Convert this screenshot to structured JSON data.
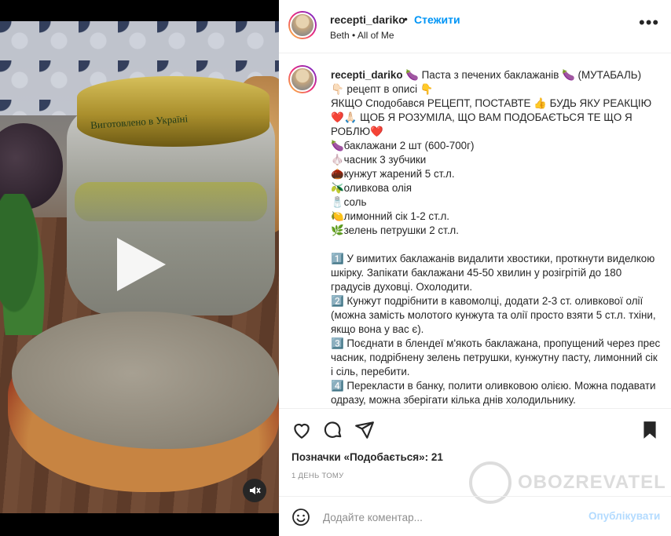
{
  "media": {
    "lid_text": "Виготовлено в Україні",
    "play_icon": "play-icon",
    "mute_icon": "muted-speaker-icon"
  },
  "header": {
    "username": "recepti_dariko",
    "separator": "•",
    "follow_label": "Стежити",
    "music": "Beth • All of Me",
    "more_icon": "more-options-icon"
  },
  "caption": {
    "username": "recepti_dariko",
    "text": " 🍆 Паста з печених баклажанів 🍆 (МУТАБАЛЬ)\n👇🏻 рецепт в описі 👇\nЯКЩО Сподобався РЕЦЕПТ, ПОСТАВТЕ 👍 БУДЬ ЯКУ РЕАКЦІЮ ❤️🙏🏻 ЩОБ Я РОЗУМІЛА, ЩО ВАМ ПОДОБАЄТЬСЯ ТЕ ЩО Я РОБЛЮ❤️\n🍆баклажани 2 шт (600-700г)\n🧄часник 3 зубчики\n🌰кунжут жарений 5 ст.л.\n🫒оливкова олія\n🧂соль\n🍋лимонний сік 1-2 ст.л.\n🌿зелень петрушки 2 ст.л.\n\n1️⃣ У вимитих баклажанів видалити хвостики, проткнути виделкою шкірку. Запікати баклажани 45-50 хвилин у розігрітій до 180 градусів духовці. Охолодити.\n2️⃣ Кунжут подрібнити в кавомолці, додати 2-3 ст. оливкової олії (можна замість молотого кунжута та олії просто взяти 5 ст.л. тхіни, якщо вона у вас є).\n3️⃣ Поєднати в блендеї м'якоть баклажана, пропущений через прес часник, подрібнену зелень петрушки, кунжутну пасту, лимонний сік і сіль, перебити.\n4️⃣ Перекласти в банку, полити оливковою олією. Можна подавати одразу, можна зберігати кілька днів холодильнику."
  },
  "actions": {
    "like_icon": "heart-icon",
    "comment_icon": "comment-icon",
    "share_icon": "send-icon",
    "save_icon": "bookmark-icon"
  },
  "likes_text": "Позначки «Подобається»: 21",
  "date": "1 ДЕНЬ ТОМУ",
  "watermark": "OBOZREVATEL",
  "comment": {
    "placeholder": "Додайте коментар...",
    "publish_label": "Опублікувати",
    "emoji_icon": "emoji-icon"
  },
  "colors": {
    "accent": "#0095f6",
    "publish_disabled": "#b3dbff",
    "text": "#262626",
    "muted": "#8e8e8e"
  }
}
